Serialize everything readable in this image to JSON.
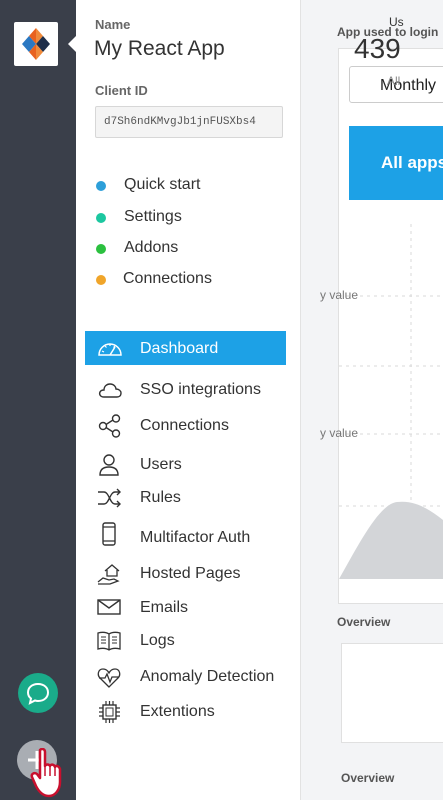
{
  "sidebar": {
    "name_label": "Name",
    "app_name": "My React App",
    "client_id_label": "Client ID",
    "client_id": "d7Sh6ndKMvgJb1jnFUSXbs4",
    "quick_links": [
      {
        "label": "Quick start",
        "color": "#2d9fd9"
      },
      {
        "label": "Settings",
        "color": "#1cc7a0"
      },
      {
        "label": "Addons",
        "color": "#2bc03f"
      },
      {
        "label": "Connections",
        "color": "#f0a52a"
      }
    ],
    "nav": [
      {
        "label": "Dashboard",
        "icon": "speedometer-icon"
      },
      {
        "label": "SSO integrations",
        "icon": "cloud-icon"
      },
      {
        "label": "Connections",
        "icon": "share-icon"
      },
      {
        "label": "Users",
        "icon": "user-icon"
      },
      {
        "label": "Rules",
        "icon": "shuffle-icon"
      },
      {
        "label": "Multifactor Auth",
        "icon": "phone-icon"
      },
      {
        "label": "Hosted Pages",
        "icon": "house-hand-icon"
      },
      {
        "label": "Emails",
        "icon": "envelope-icon"
      },
      {
        "label": "Logs",
        "icon": "book-icon"
      },
      {
        "label": "Anomaly Detection",
        "icon": "heart-pulse-icon"
      },
      {
        "label": "Extentions",
        "icon": "chip-icon"
      }
    ]
  },
  "main": {
    "chart_title": "App used to login",
    "period": "Monthly",
    "apps_button": "All apps",
    "y_label_1": "y value",
    "y_label_2": "y value",
    "overview_1": "Overview",
    "overview_2": "Overview",
    "stat_label": "Us",
    "stat_value": "439",
    "stat_sub": "All"
  },
  "colors": {
    "rail": "#3a3f4a",
    "accent": "#1da1e6",
    "chat": "#1aab8a"
  }
}
